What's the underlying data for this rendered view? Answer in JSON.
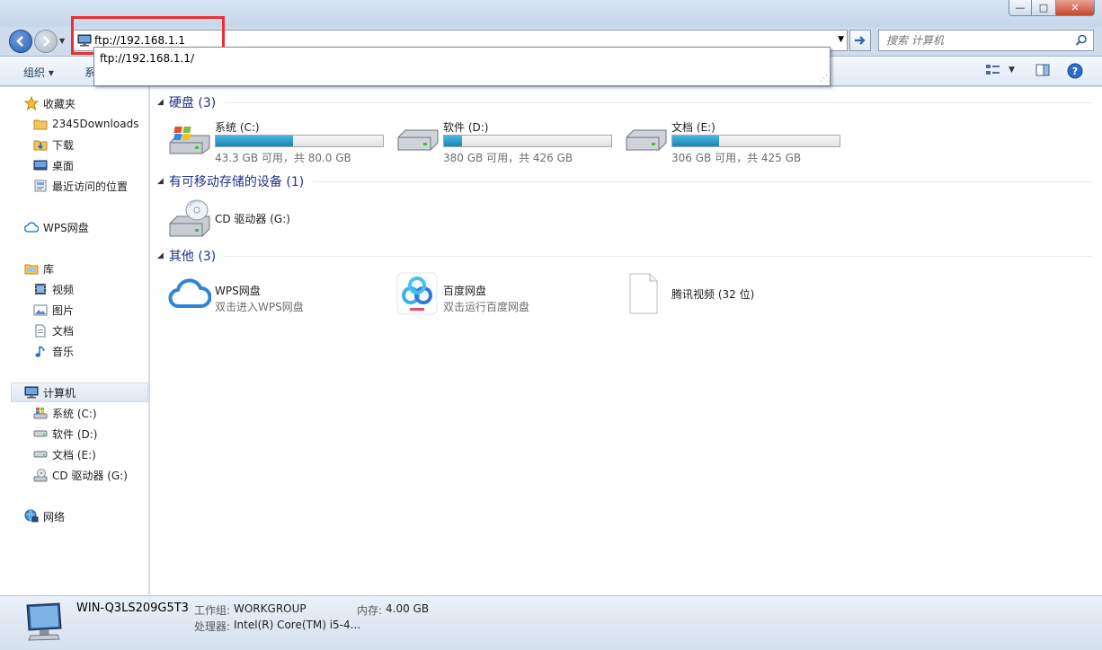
{
  "window": {
    "controls": {
      "minimize": "—",
      "maximize": "□",
      "close": "✕"
    }
  },
  "nav": {
    "address_value": "ftp://192.168.1.1",
    "search_placeholder": "搜索 计算机",
    "autocomplete": [
      "ftp://192.168.1.1/"
    ]
  },
  "toolbar": {
    "organize": "组织 ▾",
    "system_partial": "系"
  },
  "sidebar": {
    "favorites": {
      "label": "收藏夹",
      "items": [
        "2345Downloads",
        "下载",
        "桌面",
        "最近访问的位置"
      ]
    },
    "wps": "WPS网盘",
    "libraries": {
      "label": "库",
      "items": [
        "视频",
        "图片",
        "文档",
        "音乐"
      ]
    },
    "computer": {
      "label": "计算机",
      "items": [
        "系统 (C:)",
        "软件 (D:)",
        "文档 (E:)",
        "CD 驱动器 (G:)"
      ]
    },
    "network": "网络"
  },
  "content": {
    "groups": {
      "hdd": "硬盘 (3)",
      "removable": "有可移动存储的设备 (1)",
      "other": "其他 (3)"
    },
    "drives": [
      {
        "name": "系统 (C:)",
        "free_text": "43.3 GB 可用，共 80.0 GB",
        "used_fraction": 0.46
      },
      {
        "name": "软件 (D:)",
        "free_text": "380 GB 可用，共 426 GB",
        "used_fraction": 0.11
      },
      {
        "name": "文档 (E:)",
        "free_text": "306 GB 可用，共 425 GB",
        "used_fraction": 0.28
      }
    ],
    "removable": [
      {
        "name": "CD 驱动器 (G:)"
      }
    ],
    "others": [
      {
        "name": "WPS网盘",
        "desc": "双击进入WPS网盘"
      },
      {
        "name": "百度网盘",
        "desc": "双击运行百度网盘"
      },
      {
        "name": "腾讯视频 (32 位)",
        "desc": ""
      }
    ]
  },
  "details": {
    "pc_name": "WIN-Q3LS209G5T3",
    "workgroup_label": "工作组:",
    "workgroup_value": "WORKGROUP",
    "memory_label": "内存:",
    "memory_value": "4.00 GB",
    "cpu_label": "处理器:",
    "cpu_value": "Intel(R) Core(TM) i5-4..."
  }
}
